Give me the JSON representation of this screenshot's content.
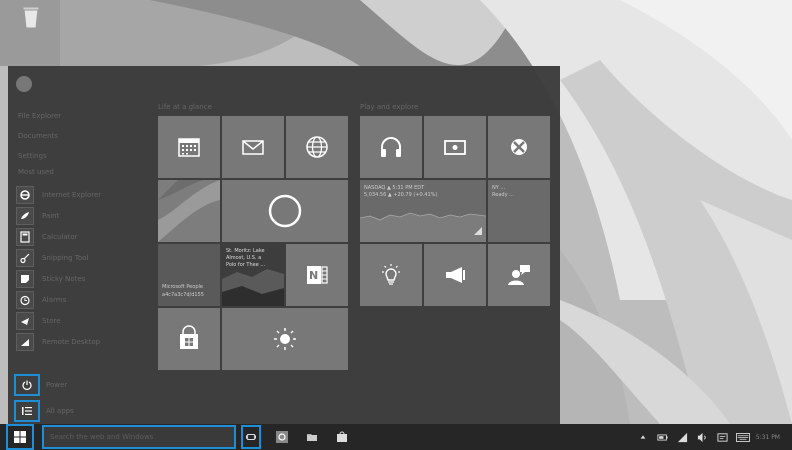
{
  "desktop": {
    "wallpaper": "gray curved panels",
    "colors": {
      "dark": "#6f6f6f",
      "mid": "#a9a9a9",
      "light": "#d4d4d4",
      "bright": "#eeeeee"
    }
  },
  "start_menu": {
    "places": [
      "File Explorer",
      "Documents",
      "Settings"
    ],
    "most_used_heading": "Most used",
    "apps": [
      {
        "label": "Internet Explorer",
        "icon": "internet-explorer-icon"
      },
      {
        "label": "Paint",
        "icon": "paint-icon"
      },
      {
        "label": "Calculator",
        "icon": "calculator-icon"
      },
      {
        "label": "Snipping Tool",
        "icon": "snipping-tool-icon"
      },
      {
        "label": "Sticky Notes",
        "icon": "sticky-notes-icon"
      },
      {
        "label": "Alarms",
        "icon": "alarm-icon"
      },
      {
        "label": "Store",
        "icon": "store-arrow-icon"
      },
      {
        "label": "Remote Desktop",
        "icon": "remote-desktop-icon"
      }
    ],
    "power_label": "Power",
    "all_apps_label": "All apps",
    "group1_heading": "Life at a glance",
    "group2_heading": "Play and explore",
    "finance_tile": {
      "line1": "NASDAQ ▲ 5:31 PM EDT",
      "line2": "5,034.56 ▲ +20.79 (+0.41%)"
    },
    "news_tile": {
      "line1": "St. Moritz: Lake",
      "line2": "Almost, U.S. a",
      "line3": "Polo for Thee ..."
    },
    "people_tile": {
      "line1": "Microsoft People",
      "line2": "a4c7a3c7d/d155"
    },
    "sports_tile": {
      "line1": "NY ...",
      "line2": "Ready ..."
    }
  },
  "taskbar": {
    "search_placeholder": "Search the web and Windows",
    "clock": "5:31 PM"
  }
}
